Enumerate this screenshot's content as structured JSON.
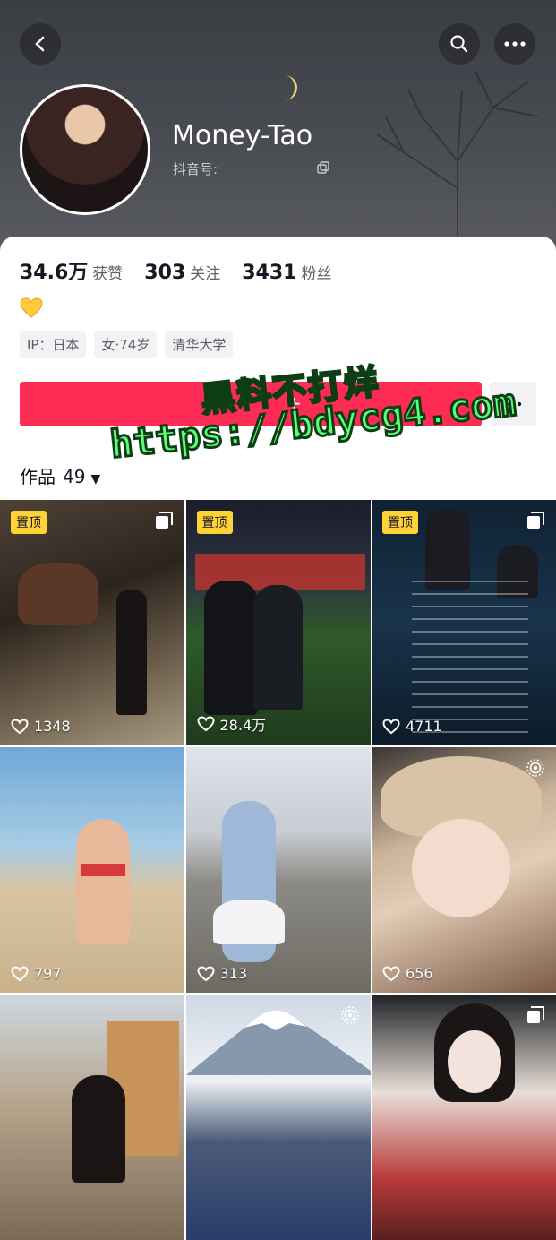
{
  "profile": {
    "name": "Money-Tao",
    "douyin_id_label": "抖音号:",
    "stats": [
      {
        "value": "34.6万",
        "label": "获赞"
      },
      {
        "value": "303",
        "label": "关注"
      },
      {
        "value": "3431",
        "label": "粉丝"
      }
    ],
    "bio_emoji": "yellow-heart",
    "tags": [
      "IP：日本",
      "女·74岁",
      "清华大学"
    ],
    "follow_plus": "+"
  },
  "tabs": {
    "works_label": "作品",
    "works_count": "49",
    "works_caret": "▼"
  },
  "watermark": {
    "line1": "黑料不打烊",
    "line2": "https://bdycg4.com"
  },
  "videos": [
    {
      "pinned": "置顶",
      "likes": "1348",
      "corner": "multi-image-icon"
    },
    {
      "pinned": "置顶",
      "likes": "28.4万",
      "corner": ""
    },
    {
      "pinned": "置顶",
      "likes": "4711",
      "corner": "multi-image-icon"
    },
    {
      "pinned": "",
      "likes": "797",
      "corner": ""
    },
    {
      "pinned": "",
      "likes": "313",
      "corner": ""
    },
    {
      "pinned": "",
      "likes": "656",
      "corner": "live-photo-icon"
    },
    {
      "pinned": "",
      "likes": "",
      "corner": ""
    },
    {
      "pinned": "",
      "likes": "",
      "corner": "live-photo-icon"
    },
    {
      "pinned": "",
      "likes": "",
      "corner": "multi-image-icon"
    }
  ],
  "colors": {
    "accent": "#fe2c55",
    "pin_badge": "#ffd235",
    "watermark": "#5cff7a"
  }
}
